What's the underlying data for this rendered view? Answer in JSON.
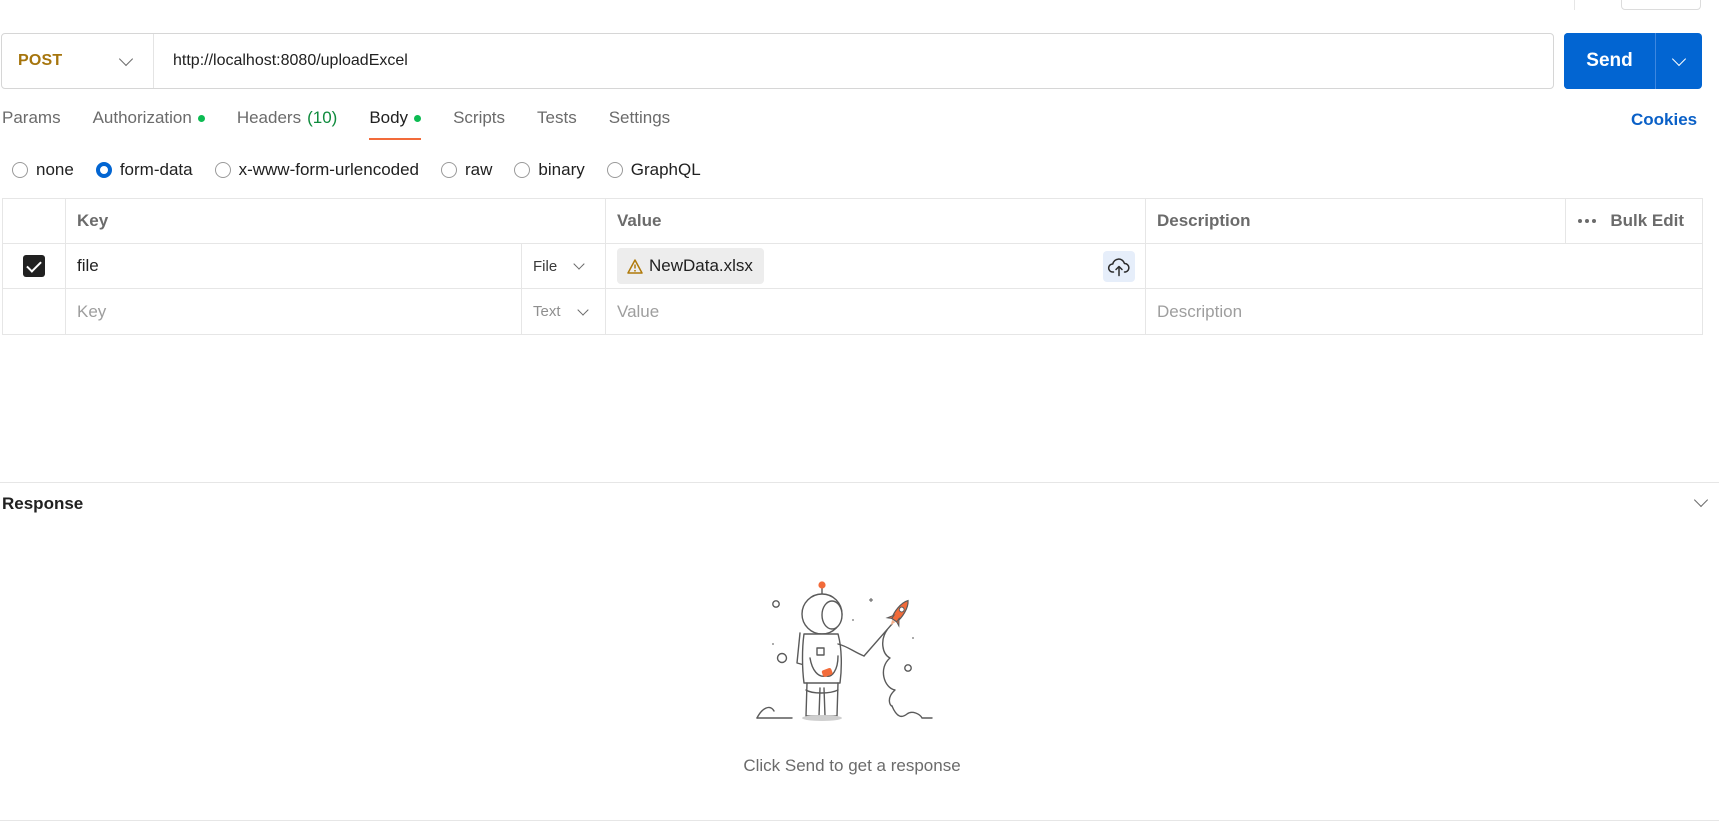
{
  "request": {
    "method": "POST",
    "url": "http://localhost:8080/uploadExcel",
    "send_label": "Send"
  },
  "tabs": [
    {
      "label": "Params",
      "active": false
    },
    {
      "label": "Authorization",
      "active": false,
      "dot": true
    },
    {
      "label": "Headers",
      "count": "(10)",
      "active": false
    },
    {
      "label": "Body",
      "active": true,
      "dot": true
    },
    {
      "label": "Scripts",
      "active": false
    },
    {
      "label": "Tests",
      "active": false
    },
    {
      "label": "Settings",
      "active": false
    }
  ],
  "cookies_label": "Cookies",
  "body_types": [
    {
      "label": "none",
      "selected": false
    },
    {
      "label": "form-data",
      "selected": true
    },
    {
      "label": "x-www-form-urlencoded",
      "selected": false
    },
    {
      "label": "raw",
      "selected": false
    },
    {
      "label": "binary",
      "selected": false
    },
    {
      "label": "GraphQL",
      "selected": false
    }
  ],
  "table": {
    "headers": {
      "key": "Key",
      "value": "Value",
      "description": "Description",
      "bulk_edit": "Bulk Edit"
    },
    "rows": [
      {
        "checked": true,
        "key": "file",
        "type": "File",
        "value": "NewData.xlsx",
        "description": ""
      }
    ],
    "placeholder_row": {
      "key": "Key",
      "type": "Text",
      "value": "Value",
      "description": "Description"
    }
  },
  "response": {
    "title": "Response",
    "empty_message": "Click Send to get a response"
  },
  "colors": {
    "send_blue": "#0265d2",
    "method_post": "#a6750d",
    "active_tab_underline": "#f26b3a",
    "status_dot": "#0cbb52",
    "cookies_link": "#0a60c7"
  },
  "icons": [
    "chevron-down-icon",
    "checkbox-checked-icon",
    "warning-icon",
    "cloud-upload-icon",
    "more-horizontal-icon",
    "astronaut-rocket-illustration"
  ]
}
